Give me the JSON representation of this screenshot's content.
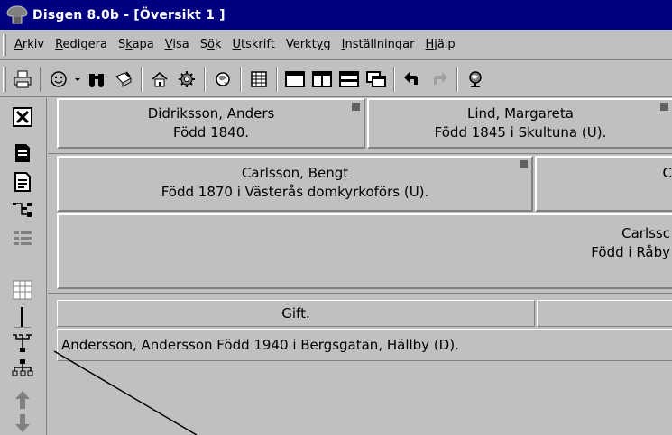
{
  "window": {
    "title": "Disgen 8.0b - [Översikt 1 ]"
  },
  "menu": [
    {
      "pre": "",
      "key": "A",
      "post": "rkiv"
    },
    {
      "pre": "",
      "key": "R",
      "post": "edigera"
    },
    {
      "pre": "S",
      "key": "k",
      "post": "apa"
    },
    {
      "pre": "",
      "key": "V",
      "post": "isa"
    },
    {
      "pre": "S",
      "key": "ö",
      "post": "k"
    },
    {
      "pre": "",
      "key": "U",
      "post": "tskrift"
    },
    {
      "pre": "Verkt",
      "key": "y",
      "post": "g"
    },
    {
      "pre": "",
      "key": "I",
      "post": "nställningar"
    },
    {
      "pre": "",
      "key": "H",
      "post": "jälp"
    }
  ],
  "toolbar": {
    "icons": [
      "print-icon",
      "face-icon",
      "dropdown-arrow-icon",
      "binoculars-icon",
      "edit-card-icon",
      "home-icon",
      "gear-icon",
      "globe-icon",
      "table-icon",
      "single-pane-icon",
      "two-column-icon",
      "horizontal-split-icon",
      "cascade-windows-icon",
      "back-arrow-icon",
      "forward-arrow-icon",
      "world-icon"
    ]
  },
  "sidebar": {
    "icons": [
      "close-window-icon",
      "document-icon",
      "document-text-icon",
      "connector-icon",
      "list-grid-icon",
      "grid-icon",
      "vertical-line-icon",
      "ancestor-tree-icon",
      "descendant-tree-icon",
      "up-arrow-icon",
      "down-arrow-icon"
    ]
  },
  "overview": {
    "grandparents": [
      {
        "name": "Didriksson, Anders",
        "detail": "Född 1840."
      },
      {
        "name": "Lind, Margareta",
        "detail": "Född 1845 i Skultuna (U)."
      }
    ],
    "parents": [
      {
        "name": "Carlsson, Bengt",
        "detail": "Född 1870 i Västerås domkyrkoförs (U)."
      },
      {
        "name": "C",
        "detail": ""
      }
    ],
    "main_person": {
      "name": "Carlssc",
      "detail": "Född i Råby"
    },
    "marriages": [
      {
        "label": "Gift."
      },
      {
        "label": ""
      }
    ],
    "spouse_line": "Andersson, Andersson Född 1940 i Bergsgatan, Hällby (D)."
  }
}
